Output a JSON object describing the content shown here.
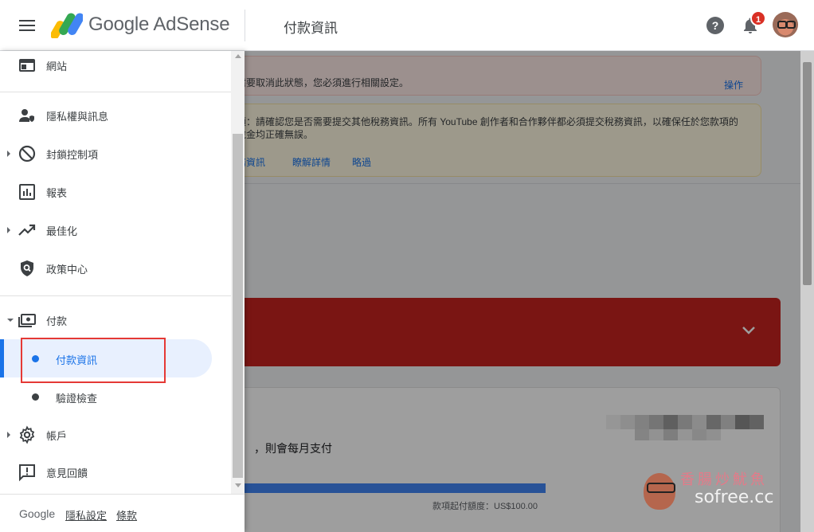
{
  "header": {
    "brand": "Google AdSense",
    "page_title": "付款資訊",
    "notification_count": "1"
  },
  "sidebar": {
    "items": [
      {
        "label": "網站",
        "icon": "web-icon"
      },
      {
        "label": "隱私權與訊息",
        "icon": "privacy-icon"
      },
      {
        "label": "封鎖控制項",
        "icon": "block-icon"
      },
      {
        "label": "報表",
        "icon": "report-icon"
      },
      {
        "label": "最佳化",
        "icon": "trending-up-icon"
      },
      {
        "label": "政策中心",
        "icon": "policy-icon"
      },
      {
        "label": "付款",
        "icon": "payments-icon"
      },
      {
        "label": "帳戶",
        "icon": "gear-icon"
      },
      {
        "label": "意見回饋",
        "icon": "feedback-icon"
      }
    ],
    "payment_sub": [
      {
        "label": "付款資訊",
        "active": true
      },
      {
        "label": "驗證檢查",
        "active": false
      }
    ],
    "footer": {
      "google": "Google",
      "privacy": "隱私設定",
      "terms": "條款"
    }
  },
  "main": {
    "alert1": {
      "text": "需要取消此狀態，您必須進行相關設定。",
      "action": "操作"
    },
    "alert2": {
      "text": "項：請確認您是否需要提交其他稅務資訊。所有 YouTube 創作者和合作夥伴都必須提交稅務資訊，以確保任於您款項的稅金均正確無誤。",
      "links": [
        "務資訊",
        "瞭解詳情",
        "略過"
      ]
    },
    "payment_card": {
      "schedule_text": "，則會每月支付",
      "threshold_text": "款項起付額度：US$100.00",
      "progress_fraction": 1.0
    }
  },
  "watermark": {
    "chinese": "香腸炒魷魚",
    "domain": "sofree.cc"
  },
  "colors": {
    "accent": "#1a73e8",
    "alert_red": "#c5221f",
    "highlight_border": "#e53935"
  }
}
